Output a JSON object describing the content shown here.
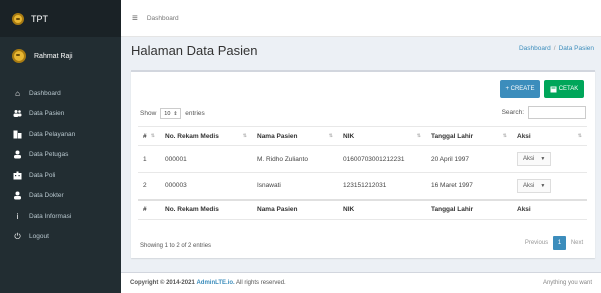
{
  "app": {
    "brand": "TPT",
    "user": "Rahmat Raji"
  },
  "sidebar": {
    "items": [
      {
        "label": "Dashboard",
        "icon": "home-icon",
        "glyph": "⌂"
      },
      {
        "label": "Data Pasien",
        "icon": "users-icon",
        "glyph": "👥"
      },
      {
        "label": "Data Pelayanan",
        "icon": "services-icon",
        "glyph": "▤"
      },
      {
        "label": "Data Petugas",
        "icon": "user-icon",
        "glyph": "⚲"
      },
      {
        "label": "Data Poli",
        "icon": "hospital-icon",
        "glyph": "▦"
      },
      {
        "label": "Data Dokter",
        "icon": "doctor-icon",
        "glyph": "⚲"
      },
      {
        "label": "Data Informasi",
        "icon": "info-icon",
        "glyph": "i"
      },
      {
        "label": "Logout",
        "icon": "power-icon",
        "glyph": "⏻"
      }
    ]
  },
  "header": {
    "text": "Dashboard"
  },
  "page": {
    "title": "Halaman Data Pasien"
  },
  "breadcrumb": {
    "home": "Dashboard",
    "separator": "/",
    "current": "Data Pasien"
  },
  "buttons": {
    "create": "+ CREATE",
    "cetak": "CETAK"
  },
  "table_controls": {
    "show": "Show",
    "entries_value": "10",
    "entries": "entries",
    "search": "Search:"
  },
  "table": {
    "headers": [
      "#",
      "No. Rekam Medis",
      "Nama Pasien",
      "NIK",
      "Tanggal Lahir",
      "Aksi"
    ],
    "rows": [
      {
        "num": "1",
        "rekam_medis": "000001",
        "nama": "M. Ridho Zulianto",
        "nik": "01600703001212231",
        "tgl": "20 April 1997",
        "aksi": "Aksi"
      },
      {
        "num": "2",
        "rekam_medis": "000003",
        "nama": "Isnawati",
        "nik": "123151212031",
        "tgl": "16 Maret 1997",
        "aksi": "Aksi"
      }
    ]
  },
  "pagination": {
    "showing": "Showing 1 to 2 of 2 entries",
    "prev": "Previous",
    "page": "1",
    "next": "Next"
  },
  "footer": {
    "copyright": "Copyright © 2014-2021",
    "brand": "AdminLTE.io.",
    "rights": "All rights reserved.",
    "right": "Anything you want"
  },
  "colors": {
    "sidebar": "#222d32",
    "primary": "#3c8dbc",
    "success": "#00a65a"
  }
}
